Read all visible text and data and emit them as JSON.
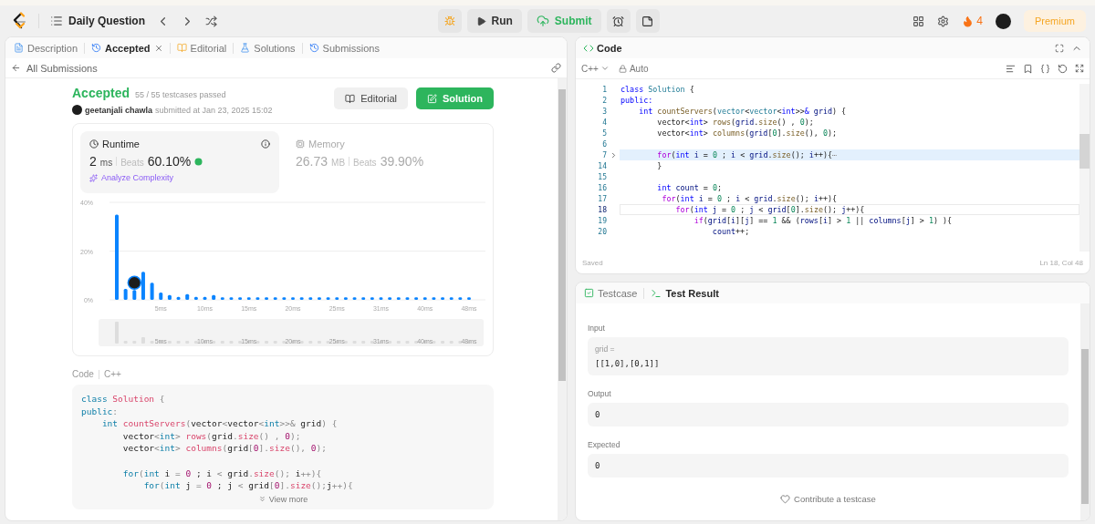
{
  "topbar": {
    "title": "Daily Question",
    "run": "Run",
    "submit": "Submit",
    "streak": "4",
    "premium": "Premium"
  },
  "left": {
    "tabs": [
      {
        "label": "Description",
        "kind": "description",
        "selected": false,
        "closable": false
      },
      {
        "label": "Accepted",
        "kind": "history",
        "selected": true,
        "closable": true
      },
      {
        "label": "Editorial",
        "kind": "editorial",
        "selected": false,
        "closable": false
      },
      {
        "label": "Solutions",
        "kind": "solutions",
        "selected": false,
        "closable": false
      },
      {
        "label": "Submissions",
        "kind": "history",
        "selected": false,
        "closable": false
      }
    ],
    "back": "All Submissions",
    "status": "Accepted",
    "passed": "55 / 55 testcases passed",
    "user": "geetanjali chawla",
    "submitted": "submitted at Jan 23, 2025 15:02",
    "editorial_button": "Editorial",
    "solution_button": "Solution",
    "metrics": [
      {
        "kind": "runtime",
        "title": "Runtime",
        "value": "2",
        "unit": "ms",
        "beats_label": "Beats",
        "beats": "60.10%",
        "selected": true,
        "action": "Analyze Complexity"
      },
      {
        "kind": "memory",
        "title": "Memory",
        "value": "26.73",
        "unit": "MB",
        "beats_label": "Beats",
        "beats": "39.90%",
        "selected": false
      }
    ],
    "chart_data": {
      "type": "bar",
      "categories": [
        null,
        null,
        null,
        null,
        null,
        "5ms",
        null,
        null,
        null,
        null,
        "10ms",
        null,
        null,
        null,
        null,
        "15ms",
        null,
        null,
        null,
        null,
        "20ms",
        null,
        null,
        null,
        null,
        "25ms",
        null,
        null,
        null,
        null,
        "31ms",
        null,
        null,
        null,
        null,
        "40ms",
        null,
        null,
        null,
        null,
        "48ms"
      ],
      "series": [
        {
          "color": "#0a84ff",
          "values": [
            35,
            4.5,
            4,
            11.5,
            7,
            3,
            2,
            1.2,
            2.3,
            1.2,
            1.2,
            2,
            1,
            1,
            1,
            1,
            1,
            1,
            1,
            1,
            1,
            1,
            1,
            1,
            1,
            1,
            1,
            1,
            1,
            1,
            1,
            1,
            1,
            1,
            1,
            1,
            1,
            1,
            1,
            1,
            1
          ]
        }
      ],
      "ylim": [
        0,
        40
      ],
      "yticks": [
        {
          "value": 0,
          "label": "0%"
        },
        {
          "value": 20,
          "label": "20%"
        },
        {
          "value": 40,
          "label": "40%"
        }
      ]
    },
    "range_labels": [
      "5ms",
      "10ms",
      "15ms",
      "20ms",
      "25ms",
      "31ms",
      "40ms",
      "48ms"
    ],
    "code_label": "Code",
    "code_lang": "C++",
    "code": [
      {
        "segments": [
          {
            "kind": "kw",
            "text": "class "
          },
          {
            "kind": "fn",
            "text": "Solution"
          },
          {
            "kind": "pu",
            "text": " {"
          }
        ]
      },
      {
        "segments": [
          {
            "kind": "kw",
            "text": "public"
          },
          {
            "kind": "pu",
            "text": ":"
          }
        ]
      },
      {
        "segments": [
          {
            "kind": "kw",
            "text": "    int"
          },
          {
            "kind": "fn",
            "text": " countServers"
          },
          {
            "kind": "pu",
            "text": "("
          },
          {
            "kind": "p",
            "text": "vector"
          },
          {
            "kind": "pu",
            "text": "<"
          },
          {
            "kind": "p",
            "text": "vector"
          },
          {
            "kind": "pu",
            "text": "<"
          },
          {
            "kind": "kw",
            "text": "int"
          },
          {
            "kind": "pu",
            "text": ">>&"
          },
          {
            "kind": "p",
            "text": " grid"
          },
          {
            "kind": "pu",
            "text": ") {"
          }
        ]
      },
      {
        "segments": [
          {
            "kind": "p",
            "text": "        vector"
          },
          {
            "kind": "pu",
            "text": "<"
          },
          {
            "kind": "kw",
            "text": "int"
          },
          {
            "kind": "pu",
            "text": "> "
          },
          {
            "kind": "fn",
            "text": "rows"
          },
          {
            "kind": "pu",
            "text": "("
          },
          {
            "kind": "p",
            "text": "grid"
          },
          {
            "kind": "pu",
            "text": "."
          },
          {
            "kind": "fn",
            "text": "size"
          },
          {
            "kind": "pu",
            "text": "() , "
          },
          {
            "kind": "num",
            "text": "0"
          },
          {
            "kind": "pu",
            "text": ");"
          }
        ]
      },
      {
        "segments": [
          {
            "kind": "p",
            "text": "        vector"
          },
          {
            "kind": "pu",
            "text": "<"
          },
          {
            "kind": "kw",
            "text": "int"
          },
          {
            "kind": "pu",
            "text": "> "
          },
          {
            "kind": "fn",
            "text": "columns"
          },
          {
            "kind": "pu",
            "text": "("
          },
          {
            "kind": "p",
            "text": "grid"
          },
          {
            "kind": "pu",
            "text": "["
          },
          {
            "kind": "num",
            "text": "0"
          },
          {
            "kind": "pu",
            "text": "]."
          },
          {
            "kind": "fn",
            "text": "size"
          },
          {
            "kind": "pu",
            "text": "(), "
          },
          {
            "kind": "num",
            "text": "0"
          },
          {
            "kind": "pu",
            "text": ");"
          }
        ]
      },
      {
        "space_before": true,
        "segments": [
          {
            "kind": "kw",
            "text": "        for"
          },
          {
            "kind": "pu",
            "text": "("
          },
          {
            "kind": "kw",
            "text": "int"
          },
          {
            "kind": "p",
            "text": " i "
          },
          {
            "kind": "pu",
            "text": "= "
          },
          {
            "kind": "num",
            "text": "0"
          },
          {
            "kind": "p",
            "text": " ; i "
          },
          {
            "kind": "pu",
            "text": "< "
          },
          {
            "kind": "p",
            "text": "grid"
          },
          {
            "kind": "pu",
            "text": "."
          },
          {
            "kind": "fn",
            "text": "size"
          },
          {
            "kind": "pu",
            "text": "(); "
          },
          {
            "kind": "p",
            "text": "i"
          },
          {
            "kind": "pu",
            "text": "++){"
          }
        ]
      },
      {
        "segments": [
          {
            "kind": "kw",
            "text": "            for"
          },
          {
            "kind": "pu",
            "text": "("
          },
          {
            "kind": "kw",
            "text": "int"
          },
          {
            "kind": "p",
            "text": " j "
          },
          {
            "kind": "pu",
            "text": "= "
          },
          {
            "kind": "num",
            "text": "0"
          },
          {
            "kind": "p",
            "text": " ; j "
          },
          {
            "kind": "pu",
            "text": "< "
          },
          {
            "kind": "p",
            "text": "grid"
          },
          {
            "kind": "pu",
            "text": "["
          },
          {
            "kind": "num",
            "text": "0"
          },
          {
            "kind": "pu",
            "text": "]."
          },
          {
            "kind": "fn",
            "text": "size"
          },
          {
            "kind": "pu",
            "text": "();"
          },
          {
            "kind": "p",
            "text": "j"
          },
          {
            "kind": "pu",
            "text": "++){"
          }
        ]
      }
    ],
    "view_more": "View more"
  },
  "editor": {
    "title": "Code",
    "language": "C++",
    "mode": "Auto",
    "saved": "Saved",
    "cursor": "Ln 18, Col 48",
    "lines": [
      {
        "number": "1",
        "segments": [
          {
            "kind": "kw",
            "text": "class "
          },
          {
            "kind": "type",
            "text": "Solution"
          },
          {
            "kind": "p",
            "text": " {"
          }
        ]
      },
      {
        "number": "2",
        "segments": [
          {
            "kind": "kw",
            "text": "public:"
          }
        ]
      },
      {
        "number": "3",
        "segments": [
          {
            "kind": "kw",
            "text": "    int "
          },
          {
            "kind": "fn",
            "text": "countServers"
          },
          {
            "kind": "p",
            "text": "("
          },
          {
            "kind": "type",
            "text": "vector"
          },
          {
            "kind": "p",
            "text": "<"
          },
          {
            "kind": "type",
            "text": "vector"
          },
          {
            "kind": "p",
            "text": "<"
          },
          {
            "kind": "kw",
            "text": "int"
          },
          {
            "kind": "p",
            "text": ">>"
          },
          {
            "kind": "kw",
            "text": "&"
          },
          {
            "kind": "var",
            "text": " grid"
          },
          {
            "kind": "p",
            "text": ") {"
          }
        ]
      },
      {
        "number": "4",
        "segments": [
          {
            "kind": "p",
            "text": "        vector<"
          },
          {
            "kind": "kw",
            "text": "int"
          },
          {
            "kind": "p",
            "text": "> "
          },
          {
            "kind": "fn",
            "text": "rows"
          },
          {
            "kind": "p",
            "text": "("
          },
          {
            "kind": "var",
            "text": "grid"
          },
          {
            "kind": "p",
            "text": "."
          },
          {
            "kind": "fn",
            "text": "size"
          },
          {
            "kind": "p",
            "text": "() , "
          },
          {
            "kind": "num",
            "text": "0"
          },
          {
            "kind": "p",
            "text": ");"
          }
        ]
      },
      {
        "number": "5",
        "segments": [
          {
            "kind": "p",
            "text": "        vector<"
          },
          {
            "kind": "kw",
            "text": "int"
          },
          {
            "kind": "p",
            "text": "> "
          },
          {
            "kind": "fn",
            "text": "columns"
          },
          {
            "kind": "p",
            "text": "("
          },
          {
            "kind": "var",
            "text": "grid"
          },
          {
            "kind": "p",
            "text": "["
          },
          {
            "kind": "num",
            "text": "0"
          },
          {
            "kind": "p",
            "text": "]."
          },
          {
            "kind": "fn",
            "text": "size"
          },
          {
            "kind": "p",
            "text": "(), "
          },
          {
            "kind": "num",
            "text": "0"
          },
          {
            "kind": "p",
            "text": ");"
          }
        ]
      },
      {
        "number": "6"
      },
      {
        "number": "7",
        "folded": true,
        "highlighted": true,
        "fold_mark": "⋯",
        "segments": [
          {
            "kind": "ctrl",
            "text": "        for"
          },
          {
            "kind": "p",
            "text": "("
          },
          {
            "kind": "kw",
            "text": "int"
          },
          {
            "kind": "var",
            "text": " i"
          },
          {
            "kind": "p",
            "text": " = "
          },
          {
            "kind": "num",
            "text": "0"
          },
          {
            "kind": "p",
            "text": " ; "
          },
          {
            "kind": "var",
            "text": "i"
          },
          {
            "kind": "p",
            "text": " < "
          },
          {
            "kind": "var",
            "text": "grid"
          },
          {
            "kind": "p",
            "text": "."
          },
          {
            "kind": "fn",
            "text": "size"
          },
          {
            "kind": "p",
            "text": "(); "
          },
          {
            "kind": "var",
            "text": "i"
          },
          {
            "kind": "p",
            "text": "++){"
          }
        ]
      },
      {
        "number": "14",
        "segments": [
          {
            "kind": "p",
            "text": "        }"
          }
        ]
      },
      {
        "number": "15"
      },
      {
        "number": "16",
        "segments": [
          {
            "kind": "kw",
            "text": "        int"
          },
          {
            "kind": "var",
            "text": " count"
          },
          {
            "kind": "p",
            "text": " = "
          },
          {
            "kind": "num",
            "text": "0"
          },
          {
            "kind": "p",
            "text": ";"
          }
        ]
      },
      {
        "number": "17",
        "segments": [
          {
            "kind": "ctrl",
            "text": "         for"
          },
          {
            "kind": "p",
            "text": "("
          },
          {
            "kind": "kw",
            "text": "int"
          },
          {
            "kind": "var",
            "text": " i"
          },
          {
            "kind": "p",
            "text": " = "
          },
          {
            "kind": "num",
            "text": "0"
          },
          {
            "kind": "p",
            "text": " ; "
          },
          {
            "kind": "var",
            "text": "i"
          },
          {
            "kind": "p",
            "text": " < "
          },
          {
            "kind": "var",
            "text": "grid"
          },
          {
            "kind": "p",
            "text": "."
          },
          {
            "kind": "fn",
            "text": "size"
          },
          {
            "kind": "p",
            "text": "(); "
          },
          {
            "kind": "var",
            "text": "i"
          },
          {
            "kind": "p",
            "text": "++){"
          }
        ]
      },
      {
        "number": "18",
        "current": true,
        "segments": [
          {
            "kind": "ctrl",
            "text": "            for"
          },
          {
            "kind": "p",
            "text": "("
          },
          {
            "kind": "kw",
            "text": "int"
          },
          {
            "kind": "var",
            "text": " j"
          },
          {
            "kind": "p",
            "text": " = "
          },
          {
            "kind": "num",
            "text": "0"
          },
          {
            "kind": "p",
            "text": " ; "
          },
          {
            "kind": "var",
            "text": "j"
          },
          {
            "kind": "p",
            "text": " < "
          },
          {
            "kind": "var",
            "text": "grid"
          },
          {
            "kind": "p",
            "text": "["
          },
          {
            "kind": "num",
            "text": "0"
          },
          {
            "kind": "p",
            "text": "]."
          },
          {
            "kind": "fn",
            "text": "size"
          },
          {
            "kind": "p",
            "text": "(); "
          },
          {
            "kind": "var",
            "text": "j"
          },
          {
            "kind": "p",
            "text": "++){"
          }
        ]
      },
      {
        "number": "19",
        "segments": [
          {
            "kind": "ctrl",
            "text": "                if"
          },
          {
            "kind": "p",
            "text": "("
          },
          {
            "kind": "var",
            "text": "grid"
          },
          {
            "kind": "p",
            "text": "["
          },
          {
            "kind": "var",
            "text": "i"
          },
          {
            "kind": "p",
            "text": "]["
          },
          {
            "kind": "var",
            "text": "j"
          },
          {
            "kind": "p",
            "text": "] == "
          },
          {
            "kind": "num",
            "text": "1"
          },
          {
            "kind": "p",
            "text": " && ("
          },
          {
            "kind": "var",
            "text": "rows"
          },
          {
            "kind": "p",
            "text": "["
          },
          {
            "kind": "var",
            "text": "i"
          },
          {
            "kind": "p",
            "text": "] > "
          },
          {
            "kind": "num",
            "text": "1"
          },
          {
            "kind": "p",
            "text": " || "
          },
          {
            "kind": "var",
            "text": "columns"
          },
          {
            "kind": "p",
            "text": "["
          },
          {
            "kind": "var",
            "text": "j"
          },
          {
            "kind": "p",
            "text": "] > "
          },
          {
            "kind": "num",
            "text": "1"
          },
          {
            "kind": "p",
            "text": ") ){"
          }
        ]
      },
      {
        "number": "20",
        "segments": [
          {
            "kind": "var",
            "text": "                    count"
          },
          {
            "kind": "p",
            "text": "++;"
          }
        ]
      }
    ]
  },
  "tests": {
    "tabs": [
      {
        "label": "Testcase",
        "kind": "testcase",
        "selected": false
      },
      {
        "label": "Test Result",
        "kind": "result",
        "selected": true
      }
    ],
    "input_label": "Input",
    "param": "grid =",
    "input": "[[1,0],[0,1]]",
    "output_label": "Output",
    "output": "0",
    "expected_label": "Expected",
    "expected": "0",
    "contribute": "Contribute a testcase"
  }
}
